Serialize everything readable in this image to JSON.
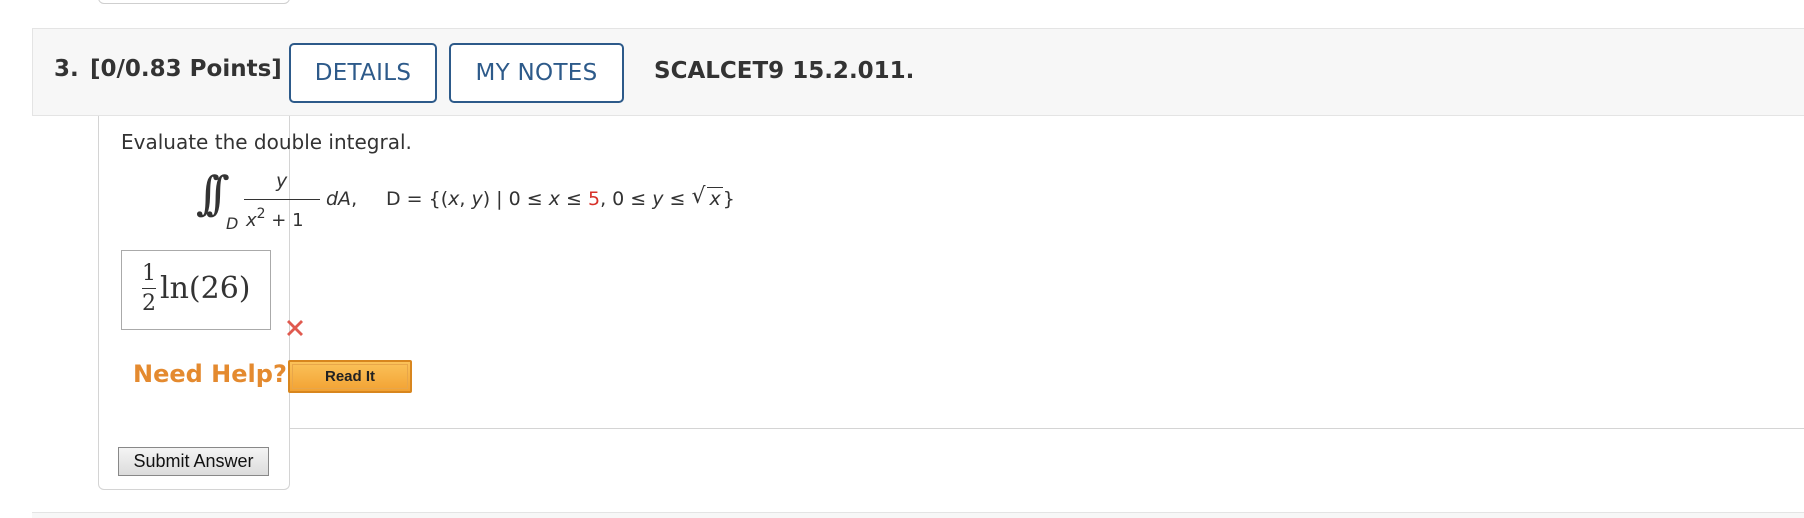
{
  "question": {
    "number": "3.",
    "points": "[0/0.83 Points]",
    "details_label": "DETAILS",
    "notes_label": "MY NOTES",
    "source": "SCALCET9 15.2.011."
  },
  "prompt": "Evaluate the double integral.",
  "math": {
    "integral_symbol": "∫∫",
    "region_subscript": "D",
    "numerator": "y",
    "denominator_var": "x",
    "denominator_exp": "2",
    "denominator_rest": " + 1",
    "differential_var": "dA",
    "differential_comma": ",",
    "domain_prefix": "D = {(",
    "domain_x": "x",
    "domain_sep1": ", ",
    "domain_y": "y",
    "domain_mid": ") | 0 ≤ ",
    "domain_x2": "x",
    "domain_le": " ≤ ",
    "domain_upper": "5",
    "domain_after": ", 0 ≤ ",
    "domain_y2": "y",
    "domain_le2": " ≤ ",
    "sqrt_symbol": "√",
    "sqrt_radicand": "x",
    "domain_close": "}",
    "highlight_color": "#d7312a"
  },
  "answer": {
    "numerator": "1",
    "denominator": "2",
    "rest": "ln(26)",
    "status": "incorrect"
  },
  "help": {
    "label": "Need Help?",
    "read_it_label": "Read It"
  },
  "submit_label": "Submit Answer",
  "colors": {
    "accent": "#2d5a8a",
    "help_orange": "#e48a2f",
    "wrong_red": "#e05a4f"
  },
  "icons": {
    "wrong": "x-mark-icon"
  }
}
